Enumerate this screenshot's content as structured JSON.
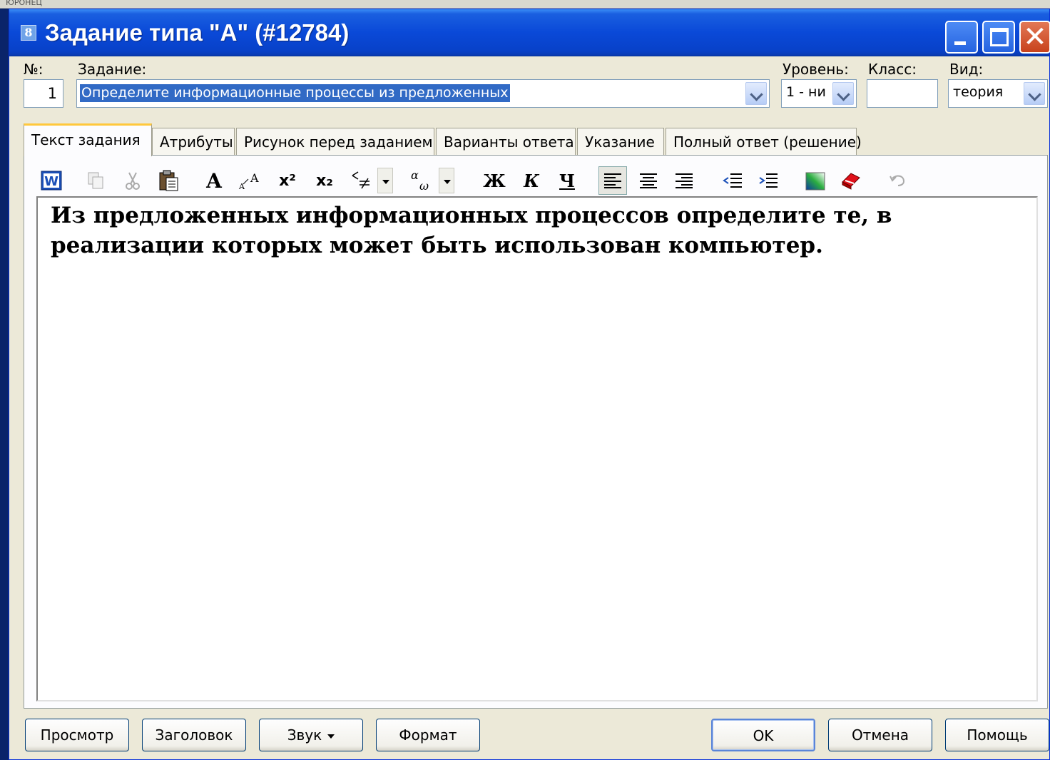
{
  "background": {
    "text": "ЮРОНЕЦ"
  },
  "window": {
    "title": "Задание типа \"А\" (#12784)"
  },
  "form": {
    "number_label": "№:",
    "number_value": "1",
    "task_label": "Задание:",
    "task_value": "Определите информационные процессы из предложенных",
    "level_label": "Уровень:",
    "level_value": "1 - ни",
    "class_label": "Класс:",
    "class_value": "",
    "kind_label": "Вид:",
    "kind_value": "теория"
  },
  "tabs": [
    {
      "label": "Текст задания",
      "active": true
    },
    {
      "label": "Атрибуты",
      "active": false
    },
    {
      "label": "Рисунок перед заданием",
      "active": false
    },
    {
      "label": "Варианты ответа",
      "active": false
    },
    {
      "label": "Указание",
      "active": false
    },
    {
      "label": "Полный ответ (решение)",
      "active": false
    }
  ],
  "toolbar": {
    "bold": "Ж",
    "italic": "К",
    "underline": "Ч",
    "font": "A",
    "superscript": "x²",
    "subscript": "x₂"
  },
  "editor": {
    "text": "Из предложенных информационных процессов определите те, в реализации которых может быть использован компьютер."
  },
  "buttons": {
    "preview": "Просмотр",
    "header": "Заголовок",
    "sound": "Звук",
    "format": "Формат",
    "ok": "OK",
    "cancel": "Отмена",
    "help": "Помощь"
  },
  "colors": {
    "title_bar": "#0a49d8",
    "accent": "#ffc83c",
    "selection": "#316ac5"
  }
}
